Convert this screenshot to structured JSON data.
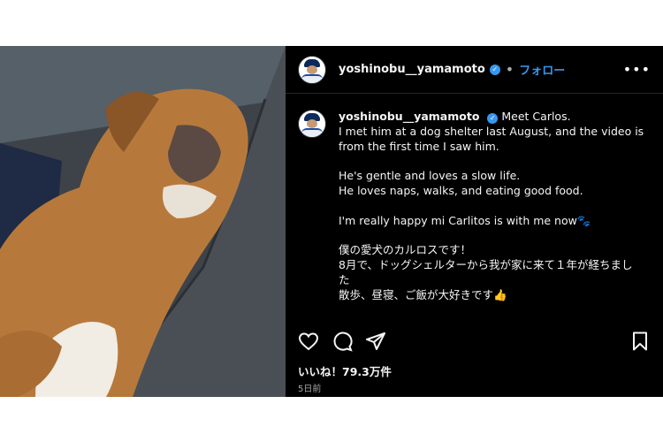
{
  "post": {
    "username": "yoshinobu__yamamoto",
    "dot": "•",
    "follow_label": "フォロー",
    "more_label": "•••",
    "verified_glyph": "✓",
    "caption_lines": [
      "Meet Carlos.",
      "I met him at a dog shelter last August, and the video is",
      "from the first time I saw him.",
      "",
      "He's gentle and loves a slow life.",
      "He loves naps, walks, and eating good food.",
      "",
      "I'm really happy mi Carlitos is with me now🐾",
      "",
      "僕の愛犬のカルロスです！",
      "8月で、ドッグシェルターから我が家に来て１年が経ちまし",
      "た",
      "散歩、昼寝、ご飯が大好きです👍"
    ],
    "likes": "いいね！79.3万件",
    "time_ago": "5日前"
  },
  "icons": {
    "like": "heart-icon",
    "comment": "comment-icon",
    "share": "send-icon",
    "save": "bookmark-icon",
    "verified": "verified-badge-icon"
  },
  "colors": {
    "accent": "#3897f0",
    "background": "#000000"
  }
}
